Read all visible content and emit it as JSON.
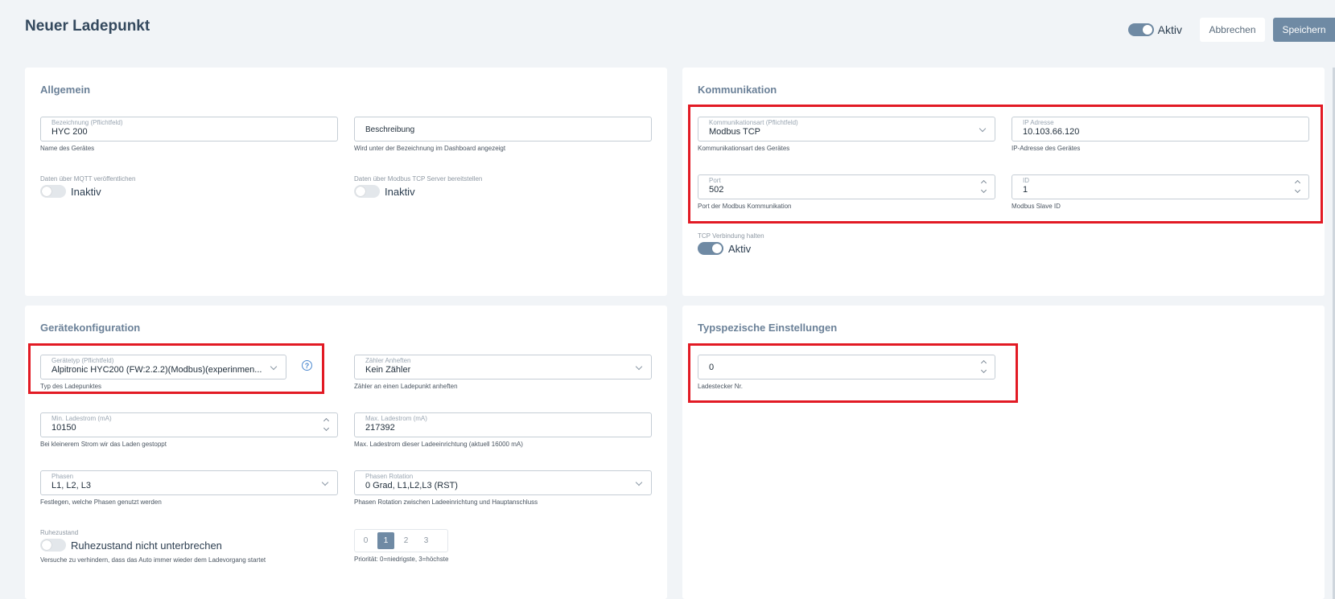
{
  "header": {
    "title": "Neuer Ladepunkt",
    "active_label": "Aktiv",
    "active_on": true,
    "cancel_label": "Abbrechen",
    "save_label": "Speichern"
  },
  "allgemein": {
    "title": "Allgemein",
    "bezeichnung": {
      "label": "Bezeichnung (Pflichtfeld)",
      "value": "HYC 200",
      "help": "Name des Gerätes"
    },
    "beschreibung": {
      "placeholder": "Beschreibung",
      "help": "Wird unter der Bezeichnung im Dashboard angezeigt"
    },
    "mqtt": {
      "label": "Daten über MQTT veröffentlichen",
      "state": "Inaktiv",
      "on": false
    },
    "modbus_server": {
      "label": "Daten über Modbus TCP Server bereitstellen",
      "state": "Inaktiv",
      "on": false
    }
  },
  "kommunikation": {
    "title": "Kommunikation",
    "art": {
      "label": "Kommunikationsart (Pflichtfeld)",
      "value": "Modbus TCP",
      "help": "Kommunikationsart des Gerätes"
    },
    "ip": {
      "label": "IP Adresse",
      "value": "10.103.66.120",
      "help": "IP-Adresse des Gerätes"
    },
    "port": {
      "label": "Port",
      "value": "502",
      "help": "Port der Modbus Kommunikation"
    },
    "id": {
      "label": "ID",
      "value": "1",
      "help": "Modbus Slave ID"
    },
    "tcp_halten": {
      "label": "TCP Verbindung halten",
      "state": "Aktiv",
      "on": true
    }
  },
  "geraetekonfiguration": {
    "title": "Gerätekonfiguration",
    "geraetetyp": {
      "label": "Gerätetyp (Pflichtfeld)",
      "value": "Alpitronic HYC200 (FW:2.2.2)(Modbus)(experinmen...",
      "help": "Typ des Ladepunktes"
    },
    "zaehler": {
      "label": "Zähler Anheften",
      "value": "Kein Zähler",
      "help": "Zähler an einen Ladepunkt anheften"
    },
    "min_strom": {
      "label": "Min. Ladestrom (mA)",
      "value": "10150",
      "help": "Bei kleinerem Strom wir das Laden gestoppt"
    },
    "max_strom": {
      "label": "Max. Ladestrom (mA)",
      "value": "217392",
      "help": "Max. Ladestrom dieser Ladeeinrichtung (aktuell 16000 mA)"
    },
    "phasen": {
      "label": "Phasen",
      "value": "L1, L2, L3",
      "help": "Festlegen, welche Phasen genutzt werden"
    },
    "phasen_rotation": {
      "label": "Phasen Rotation",
      "value": "0 Grad, L1,L2,L3 (RST)",
      "help": "Phasen Rotation zwischen Ladeeinrichtung und Hauptanschluss"
    },
    "ruhezustand": {
      "label": "Ruhezustand",
      "state": "Ruhezustand nicht unterbrechen",
      "on": false,
      "help": "Versuche zu verhindern, dass das Auto immer wieder dem Ladevorgang startet"
    },
    "prioritaet": {
      "options": [
        "0",
        "1",
        "2",
        "3"
      ],
      "selected": "1",
      "help": "Priorität: 0=niedrigste, 3=höchste"
    }
  },
  "typspezifisch": {
    "title": "Typspezische Einstellungen",
    "ladestecker": {
      "value": "0",
      "help": "Ladestecker Nr."
    }
  },
  "colors": {
    "accent": "#6f8aa4",
    "highlight_box": "#e21a24",
    "background": "#f1f4f7"
  }
}
